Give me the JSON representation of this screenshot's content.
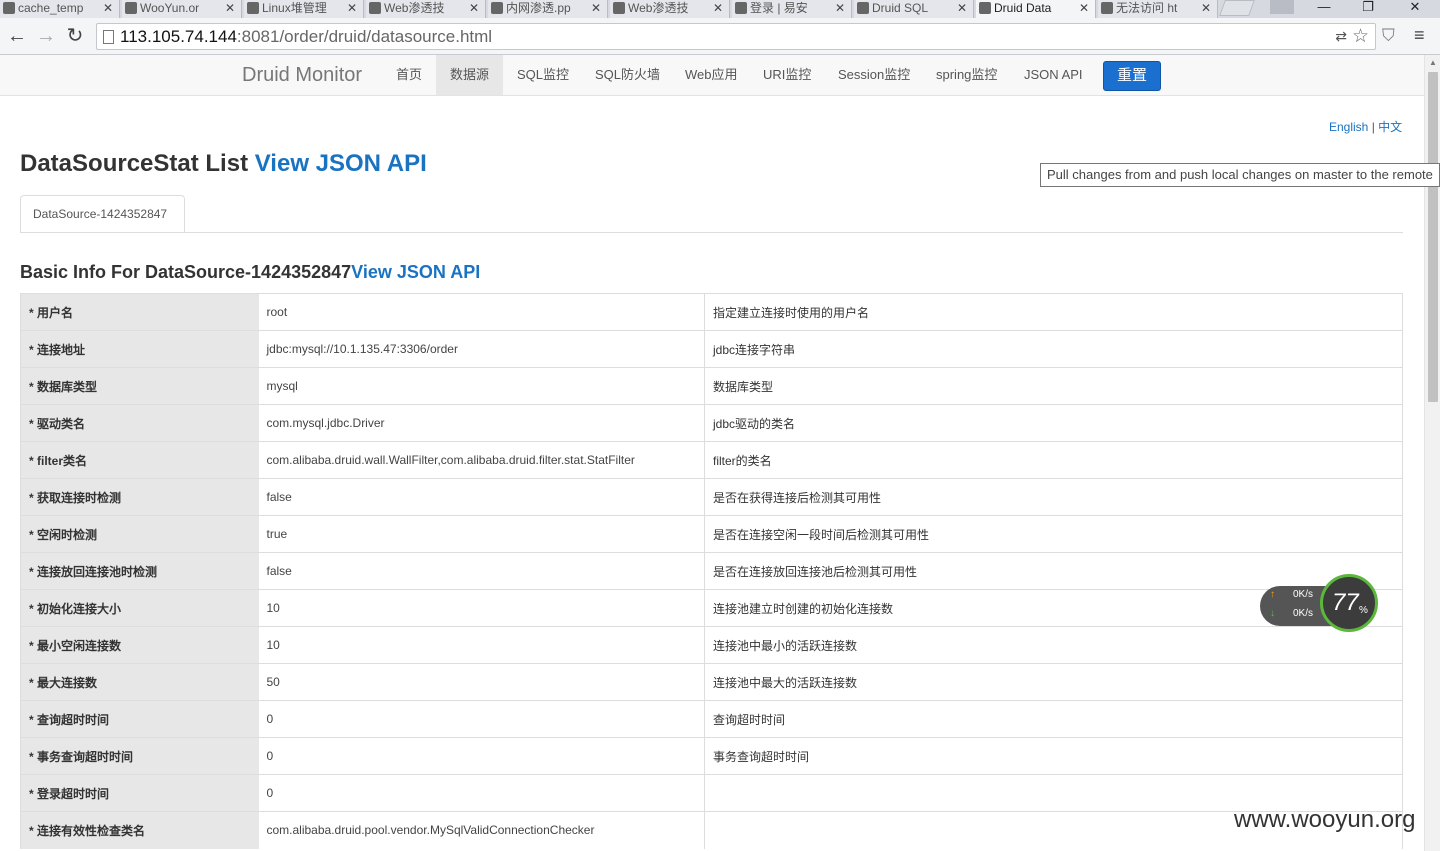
{
  "browser": {
    "tabs": [
      {
        "label": "cache_temp",
        "icon": "github-icon",
        "active": false
      },
      {
        "label": "WooYun.or",
        "icon": "wooyun-icon",
        "active": false
      },
      {
        "label": "Linux堆管理",
        "icon": "page-icon",
        "active": false
      },
      {
        "label": "Web渗透技",
        "icon": "slideshare-icon",
        "active": false
      },
      {
        "label": "内网渗透.pp",
        "icon": "cloud-icon",
        "active": false
      },
      {
        "label": "Web渗透技",
        "icon": "document-icon",
        "active": false
      },
      {
        "label": "登录 | 易安",
        "icon": "page-icon",
        "active": false
      },
      {
        "label": "Druid SQL",
        "icon": "page-icon",
        "active": false
      },
      {
        "label": "Druid Data",
        "icon": "page-icon",
        "active": true
      },
      {
        "label": "无法访问 ht",
        "icon": "document-icon",
        "active": false
      }
    ],
    "tab_close": "✕",
    "win_min": "—",
    "win_max": "❐",
    "win_close": "✕",
    "url_host": "113.105.74.144",
    "url_rest": ":8081/order/druid/datasource.html"
  },
  "nav": {
    "brand": "Druid Monitor",
    "items": [
      "首页",
      "数据源",
      "SQL监控",
      "SQL防火墙",
      "Web应用",
      "URI监控",
      "Session监控",
      "spring监控",
      "JSON API"
    ],
    "active_index": 1,
    "reset": "重置"
  },
  "lang": {
    "english": "English",
    "sep": "|",
    "chinese": "中文"
  },
  "title": {
    "main": "DataSourceStat List ",
    "link": "View JSON API"
  },
  "tooltip": "Pull changes from and push local changes on master to the remote",
  "ds_tab": "DataSource-1424352847",
  "subtitle": {
    "main": "Basic Info For DataSource-1424352847",
    "link": "View JSON API"
  },
  "rows": [
    {
      "key": "* 用户名",
      "value": "root",
      "desc": "指定建立连接时使用的用户名"
    },
    {
      "key": "* 连接地址",
      "value": "jdbc:mysql://10.1.135.47:3306/order",
      "desc": "jdbc连接字符串"
    },
    {
      "key": "* 数据库类型",
      "value": "mysql",
      "desc": "数据库类型"
    },
    {
      "key": "* 驱动类名",
      "value": "com.mysql.jdbc.Driver",
      "desc": "jdbc驱动的类名"
    },
    {
      "key": "* filter类名",
      "value": "com.alibaba.druid.wall.WallFilter,com.alibaba.druid.filter.stat.StatFilter",
      "desc": "filter的类名"
    },
    {
      "key": "* 获取连接时检测",
      "value": "false",
      "desc": "是否在获得连接后检测其可用性"
    },
    {
      "key": "* 空闲时检测",
      "value": "true",
      "desc": "是否在连接空闲一段时间后检测其可用性"
    },
    {
      "key": "* 连接放回连接池时检测",
      "value": "false",
      "desc": "是否在连接放回连接池后检测其可用性"
    },
    {
      "key": "* 初始化连接大小",
      "value": "10",
      "desc": "连接池建立时创建的初始化连接数"
    },
    {
      "key": "* 最小空闲连接数",
      "value": "10",
      "desc": "连接池中最小的活跃连接数"
    },
    {
      "key": "* 最大连接数",
      "value": "50",
      "desc": "连接池中最大的活跃连接数"
    },
    {
      "key": "* 查询超时时间",
      "value": "0",
      "desc": "查询超时时间"
    },
    {
      "key": "* 事务查询超时时间",
      "value": "0",
      "desc": "事务查询超时时间"
    },
    {
      "key": "* 登录超时时间",
      "value": "0",
      "desc": ""
    },
    {
      "key": "* 连接有效性检查类名",
      "value": "com.alibaba.druid.pool.vendor.MySqlValidConnectionChecker",
      "desc": ""
    }
  ],
  "speed_widget": {
    "up": "0K/s",
    "down": "0K/s",
    "percent": "77",
    "percent_sign": "%"
  },
  "watermark": "www.wooyun.org",
  "colors": {
    "link": "#1a73c2",
    "reset_button": "#1a6fcf",
    "key_cell": "#e7e7e7"
  }
}
